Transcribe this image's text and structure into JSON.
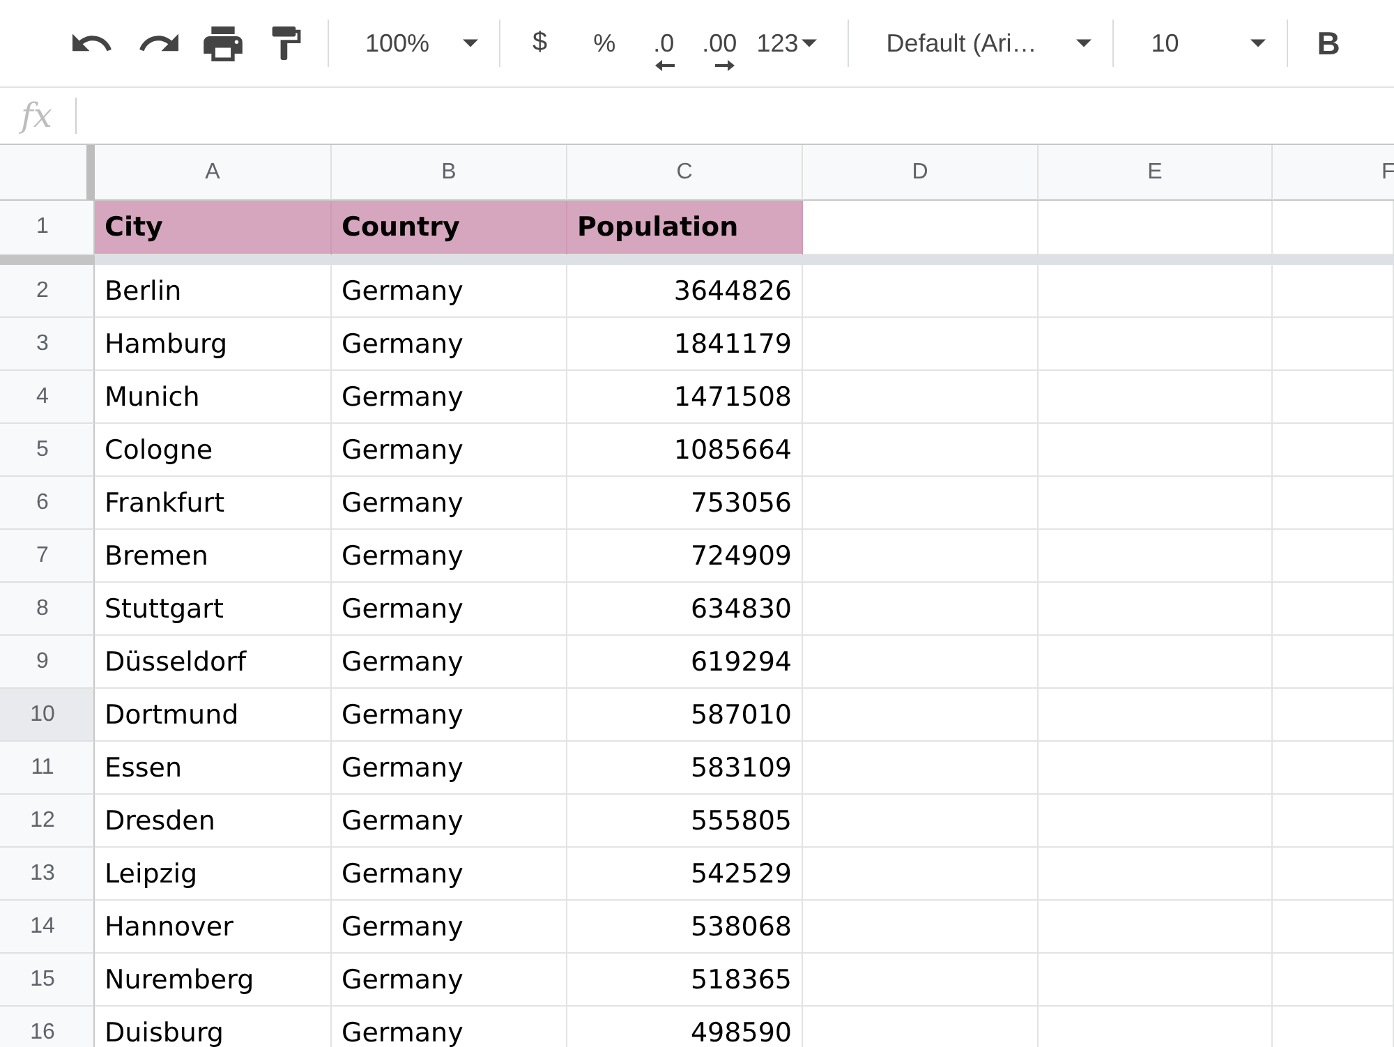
{
  "toolbar": {
    "zoom": "100%",
    "currency": "$",
    "percent": "%",
    "decrease_decimal": ".0",
    "increase_decimal": ".00",
    "number_format": "123",
    "font": "Default (Ari…",
    "font_size": "10",
    "bold": "B"
  },
  "formula_bar": {
    "label": "fx"
  },
  "sheet": {
    "columns": [
      "A",
      "B",
      "C",
      "D",
      "E",
      "F"
    ],
    "rows": [
      {
        "number": "1",
        "kind": "header",
        "selected": false,
        "cells": [
          "City",
          "Country",
          "Population"
        ]
      },
      {
        "number": "2",
        "kind": "data",
        "selected": false,
        "cells": [
          "Berlin",
          "Germany",
          "3644826"
        ]
      },
      {
        "number": "3",
        "kind": "data",
        "selected": false,
        "cells": [
          "Hamburg",
          "Germany",
          "1841179"
        ]
      },
      {
        "number": "4",
        "kind": "data",
        "selected": false,
        "cells": [
          "Munich",
          "Germany",
          "1471508"
        ]
      },
      {
        "number": "5",
        "kind": "data",
        "selected": false,
        "cells": [
          "Cologne",
          "Germany",
          "1085664"
        ]
      },
      {
        "number": "6",
        "kind": "data",
        "selected": false,
        "cells": [
          "Frankfurt",
          "Germany",
          "753056"
        ]
      },
      {
        "number": "7",
        "kind": "data",
        "selected": false,
        "cells": [
          "Bremen",
          "Germany",
          "724909"
        ]
      },
      {
        "number": "8",
        "kind": "data",
        "selected": false,
        "cells": [
          "Stuttgart",
          "Germany",
          "634830"
        ]
      },
      {
        "number": "9",
        "kind": "data",
        "selected": false,
        "cells": [
          "Düsseldorf",
          "Germany",
          "619294"
        ]
      },
      {
        "number": "10",
        "kind": "data",
        "selected": true,
        "cells": [
          "Dortmund",
          "Germany",
          "587010"
        ]
      },
      {
        "number": "11",
        "kind": "data",
        "selected": false,
        "cells": [
          "Essen",
          "Germany",
          "583109"
        ]
      },
      {
        "number": "12",
        "kind": "data",
        "selected": false,
        "cells": [
          "Dresden",
          "Germany",
          "555805"
        ]
      },
      {
        "number": "13",
        "kind": "data",
        "selected": false,
        "cells": [
          "Leipzig",
          "Germany",
          "542529"
        ]
      },
      {
        "number": "14",
        "kind": "data",
        "selected": false,
        "cells": [
          "Hannover",
          "Germany",
          "538068"
        ]
      },
      {
        "number": "15",
        "kind": "data",
        "selected": false,
        "cells": [
          "Nuremberg",
          "Germany",
          "518365"
        ]
      },
      {
        "number": "16",
        "kind": "data",
        "selected": false,
        "cells": [
          "Duisburg",
          "Germany",
          "498590"
        ]
      }
    ]
  }
}
